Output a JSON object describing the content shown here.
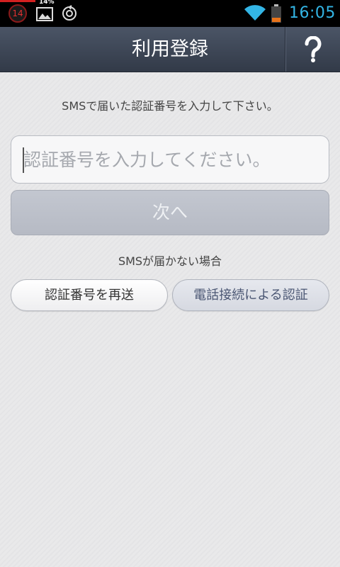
{
  "status_bar": {
    "notification_count": "14",
    "gallery_percent": "14%",
    "time": "16:05"
  },
  "header": {
    "title": "利用登録",
    "help_label": "?"
  },
  "main": {
    "instruction": "SMSで届いた認証番号を入力して下さい。",
    "code_input": {
      "placeholder": "認証番号を入力してください。",
      "value": ""
    },
    "next_button_label": "次へ",
    "no_sms_heading": "SMSが届かない場合",
    "resend_button_label": "認証番号を再送",
    "phone_auth_button_label": "電話接続による認証"
  },
  "colors": {
    "clock": "#33b5e5",
    "header_bg": "#3f4858",
    "next_button_disabled": "#bcc0ca",
    "phone_auth_text": "#4a5673"
  },
  "icons": [
    "notification-count-icon",
    "gallery-icon",
    "sync-icon",
    "wifi-icon",
    "battery-icon",
    "question-mark-icon"
  ]
}
